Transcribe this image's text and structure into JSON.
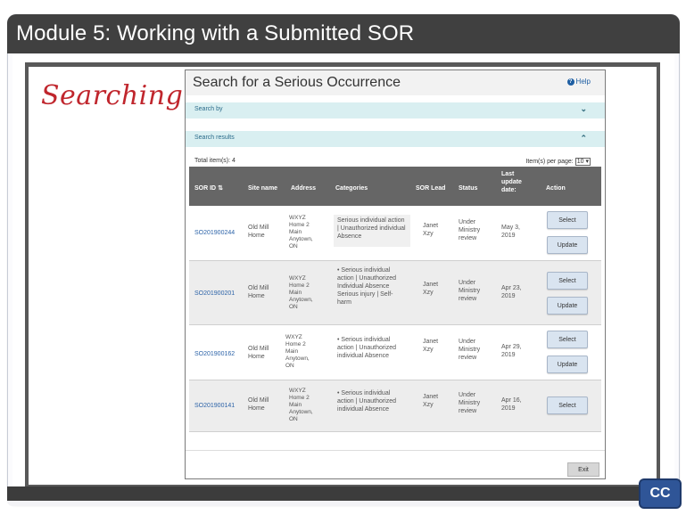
{
  "slide": {
    "title": "Module 5:  Working with a Submitted SOR",
    "side_label": "Searching",
    "cc_label": "CC"
  },
  "app": {
    "title": "Search for a Serious Occurrence",
    "help_label": "Help",
    "search_by_label": "Search by",
    "search_results_label": "Search results",
    "total_items": "Total item(s): 4",
    "per_page_label": "Item(s) per page:",
    "per_page_value": "10",
    "exit_label": "Exit",
    "columns": {
      "sor_id": "SOR ID",
      "site_name": "Site name",
      "address": "Address",
      "categories": "Categories",
      "sor_lead": "SOR Lead",
      "status": "Status",
      "last_update": "Last update date:",
      "action": "Action"
    },
    "rows": [
      {
        "sor_id": "SO201900244",
        "site_name": "Old Mill Home",
        "address": "WXYZ Home 2 Main Anytown, ON",
        "categories": "Serious individual action | Unauthorized individual Absence",
        "sor_lead": "Janet Xzy",
        "status": "Under Ministry review",
        "last_update": "May 3, 2019",
        "select": "Select",
        "update": "Update"
      },
      {
        "sor_id": "SO201900201",
        "site_name": "Old Mill Home",
        "address": "WXYZ Home 2 Main Anytown, ON",
        "categories": "• Serious individual action | Unauthorized Individual Absence Serious injury | Self-harm",
        "sor_lead": "Janet Xzy",
        "status": "Under Ministry review",
        "last_update": "Apr 23, 2019",
        "select": "Select",
        "update": "Update"
      },
      {
        "sor_id": "SO201900162",
        "site_name": "Old Mill Home",
        "address": "WXYZ Home 2 Main Anytown, ON",
        "categories": "• Serious individual action | Unauthorized individual Absence",
        "sor_lead": "Janet Xzy",
        "status": "Under Ministry review",
        "last_update": "Apr 29, 2019",
        "select": "Select",
        "update": "Update"
      },
      {
        "sor_id": "SO201900141",
        "site_name": "Old Mill Home",
        "address": "WXYZ Home 2 Main Anytown, ON",
        "categories": "• Serious individual action | Unauthorized individual Absence",
        "sor_lead": "Janet Xzy",
        "status": "Under Ministry review",
        "last_update": "Apr 16, 2019",
        "select": "Select",
        "update": ""
      }
    ]
  },
  "colors": {
    "title_bar": "#404040",
    "side_label": "#c0262d",
    "section_bar": "#d9eff1",
    "table_header": "#666666",
    "link": "#2c63a8",
    "cc_button": "#2f5597"
  }
}
